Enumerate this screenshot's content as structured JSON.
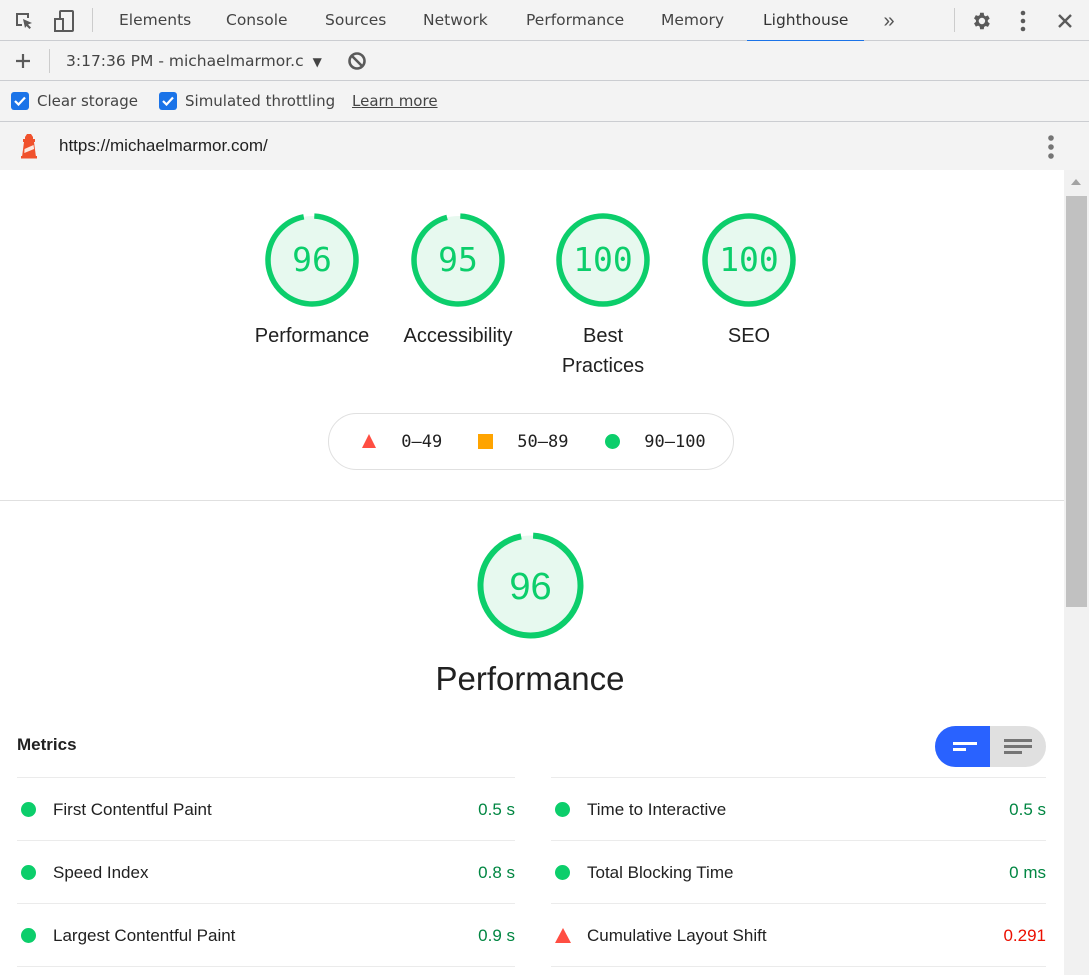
{
  "devtools": {
    "tabs": [
      "Elements",
      "Console",
      "Sources",
      "Network",
      "Performance",
      "Memory",
      "Lighthouse"
    ],
    "active_tab": "Lighthouse",
    "more_tabs_icon": "double-chevron-right-icon",
    "right_icons": [
      "gear-icon",
      "kebab-menu-icon",
      "close-icon"
    ]
  },
  "report_toolbar": {
    "new_report_icon": "plus-icon",
    "report_select": "3:17:36 PM - michaelmarmor.c",
    "clear_icon": "block-icon"
  },
  "options": {
    "clear_storage": {
      "label": "Clear storage",
      "checked": true
    },
    "simulated_throttling": {
      "label": "Simulated throttling",
      "checked": true
    },
    "learn_more": "Learn more"
  },
  "url_bar": {
    "url": "https://michaelmarmor.com/",
    "logo_icon": "lighthouse-icon",
    "menu_icon": "kebab-menu-icon"
  },
  "summary_gauges": [
    {
      "label": "Performance",
      "score": "96",
      "value": 96
    },
    {
      "label": "Accessibility",
      "score": "95",
      "value": 95
    },
    {
      "label": "Best Practices",
      "score": "100",
      "value": 100
    },
    {
      "label": "SEO",
      "score": "100",
      "value": 100
    }
  ],
  "legend": [
    {
      "range": "0–49",
      "shape": "triangle",
      "color": "#ff4e42"
    },
    {
      "range": "50–89",
      "shape": "square",
      "color": "#ffa400"
    },
    {
      "range": "90–100",
      "shape": "circle",
      "color": "#0cce6b"
    }
  ],
  "category": {
    "title": "Performance",
    "score": "96",
    "value": 96
  },
  "metrics": {
    "title": "Metrics",
    "left": [
      {
        "label": "First Contentful Paint",
        "value": "0.5 s",
        "status": "pass"
      },
      {
        "label": "Speed Index",
        "value": "0.8 s",
        "status": "pass"
      },
      {
        "label": "Largest Contentful Paint",
        "value": "0.9 s",
        "status": "pass"
      }
    ],
    "right": [
      {
        "label": "Time to Interactive",
        "value": "0.5 s",
        "status": "pass"
      },
      {
        "label": "Total Blocking Time",
        "value": "0 ms",
        "status": "pass"
      },
      {
        "label": "Cumulative Layout Shift",
        "value": "0.291",
        "status": "fail"
      }
    ]
  },
  "colors": {
    "pass": "#0cce6b",
    "pass_text": "#018642",
    "fail": "#ff4e42",
    "fail_text": "#eb0f00",
    "accent": "#1a73e8",
    "toggle_active": "#2962ff"
  }
}
